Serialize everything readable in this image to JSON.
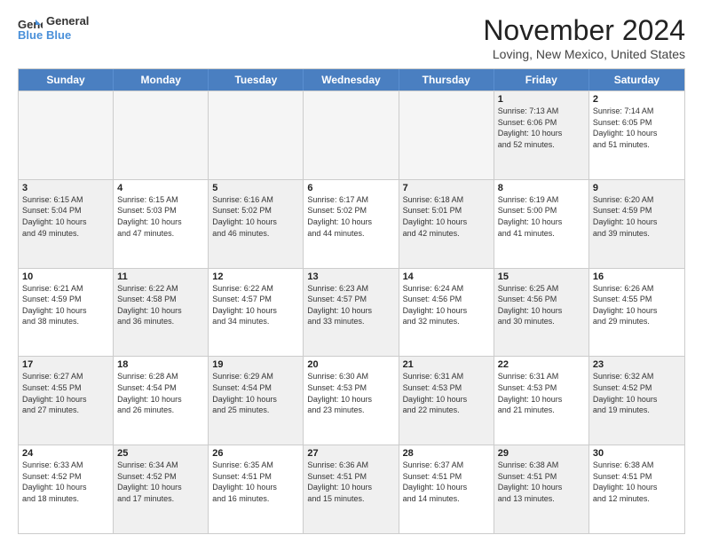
{
  "logo": {
    "line1": "General",
    "line2": "Blue"
  },
  "title": "November 2024",
  "location": "Loving, New Mexico, United States",
  "days_of_week": [
    "Sunday",
    "Monday",
    "Tuesday",
    "Wednesday",
    "Thursday",
    "Friday",
    "Saturday"
  ],
  "weeks": [
    [
      {
        "day": "",
        "info": "",
        "empty": true
      },
      {
        "day": "",
        "info": "",
        "empty": true
      },
      {
        "day": "",
        "info": "",
        "empty": true
      },
      {
        "day": "",
        "info": "",
        "empty": true
      },
      {
        "day": "",
        "info": "",
        "empty": true
      },
      {
        "day": "1",
        "info": "Sunrise: 7:13 AM\nSunset: 6:06 PM\nDaylight: 10 hours\nand 52 minutes.",
        "shaded": true
      },
      {
        "day": "2",
        "info": "Sunrise: 7:14 AM\nSunset: 6:05 PM\nDaylight: 10 hours\nand 51 minutes.",
        "shaded": false
      }
    ],
    [
      {
        "day": "3",
        "info": "Sunrise: 6:15 AM\nSunset: 5:04 PM\nDaylight: 10 hours\nand 49 minutes.",
        "shaded": true
      },
      {
        "day": "4",
        "info": "Sunrise: 6:15 AM\nSunset: 5:03 PM\nDaylight: 10 hours\nand 47 minutes.",
        "shaded": false
      },
      {
        "day": "5",
        "info": "Sunrise: 6:16 AM\nSunset: 5:02 PM\nDaylight: 10 hours\nand 46 minutes.",
        "shaded": true
      },
      {
        "day": "6",
        "info": "Sunrise: 6:17 AM\nSunset: 5:02 PM\nDaylight: 10 hours\nand 44 minutes.",
        "shaded": false
      },
      {
        "day": "7",
        "info": "Sunrise: 6:18 AM\nSunset: 5:01 PM\nDaylight: 10 hours\nand 42 minutes.",
        "shaded": true
      },
      {
        "day": "8",
        "info": "Sunrise: 6:19 AM\nSunset: 5:00 PM\nDaylight: 10 hours\nand 41 minutes.",
        "shaded": false
      },
      {
        "day": "9",
        "info": "Sunrise: 6:20 AM\nSunset: 4:59 PM\nDaylight: 10 hours\nand 39 minutes.",
        "shaded": true
      }
    ],
    [
      {
        "day": "10",
        "info": "Sunrise: 6:21 AM\nSunset: 4:59 PM\nDaylight: 10 hours\nand 38 minutes.",
        "shaded": false
      },
      {
        "day": "11",
        "info": "Sunrise: 6:22 AM\nSunset: 4:58 PM\nDaylight: 10 hours\nand 36 minutes.",
        "shaded": true
      },
      {
        "day": "12",
        "info": "Sunrise: 6:22 AM\nSunset: 4:57 PM\nDaylight: 10 hours\nand 34 minutes.",
        "shaded": false
      },
      {
        "day": "13",
        "info": "Sunrise: 6:23 AM\nSunset: 4:57 PM\nDaylight: 10 hours\nand 33 minutes.",
        "shaded": true
      },
      {
        "day": "14",
        "info": "Sunrise: 6:24 AM\nSunset: 4:56 PM\nDaylight: 10 hours\nand 32 minutes.",
        "shaded": false
      },
      {
        "day": "15",
        "info": "Sunrise: 6:25 AM\nSunset: 4:56 PM\nDaylight: 10 hours\nand 30 minutes.",
        "shaded": true
      },
      {
        "day": "16",
        "info": "Sunrise: 6:26 AM\nSunset: 4:55 PM\nDaylight: 10 hours\nand 29 minutes.",
        "shaded": false
      }
    ],
    [
      {
        "day": "17",
        "info": "Sunrise: 6:27 AM\nSunset: 4:55 PM\nDaylight: 10 hours\nand 27 minutes.",
        "shaded": true
      },
      {
        "day": "18",
        "info": "Sunrise: 6:28 AM\nSunset: 4:54 PM\nDaylight: 10 hours\nand 26 minutes.",
        "shaded": false
      },
      {
        "day": "19",
        "info": "Sunrise: 6:29 AM\nSunset: 4:54 PM\nDaylight: 10 hours\nand 25 minutes.",
        "shaded": true
      },
      {
        "day": "20",
        "info": "Sunrise: 6:30 AM\nSunset: 4:53 PM\nDaylight: 10 hours\nand 23 minutes.",
        "shaded": false
      },
      {
        "day": "21",
        "info": "Sunrise: 6:31 AM\nSunset: 4:53 PM\nDaylight: 10 hours\nand 22 minutes.",
        "shaded": true
      },
      {
        "day": "22",
        "info": "Sunrise: 6:31 AM\nSunset: 4:53 PM\nDaylight: 10 hours\nand 21 minutes.",
        "shaded": false
      },
      {
        "day": "23",
        "info": "Sunrise: 6:32 AM\nSunset: 4:52 PM\nDaylight: 10 hours\nand 19 minutes.",
        "shaded": true
      }
    ],
    [
      {
        "day": "24",
        "info": "Sunrise: 6:33 AM\nSunset: 4:52 PM\nDaylight: 10 hours\nand 18 minutes.",
        "shaded": false
      },
      {
        "day": "25",
        "info": "Sunrise: 6:34 AM\nSunset: 4:52 PM\nDaylight: 10 hours\nand 17 minutes.",
        "shaded": true
      },
      {
        "day": "26",
        "info": "Sunrise: 6:35 AM\nSunset: 4:51 PM\nDaylight: 10 hours\nand 16 minutes.",
        "shaded": false
      },
      {
        "day": "27",
        "info": "Sunrise: 6:36 AM\nSunset: 4:51 PM\nDaylight: 10 hours\nand 15 minutes.",
        "shaded": true
      },
      {
        "day": "28",
        "info": "Sunrise: 6:37 AM\nSunset: 4:51 PM\nDaylight: 10 hours\nand 14 minutes.",
        "shaded": false
      },
      {
        "day": "29",
        "info": "Sunrise: 6:38 AM\nSunset: 4:51 PM\nDaylight: 10 hours\nand 13 minutes.",
        "shaded": true
      },
      {
        "day": "30",
        "info": "Sunrise: 6:38 AM\nSunset: 4:51 PM\nDaylight: 10 hours\nand 12 minutes.",
        "shaded": false
      }
    ]
  ]
}
